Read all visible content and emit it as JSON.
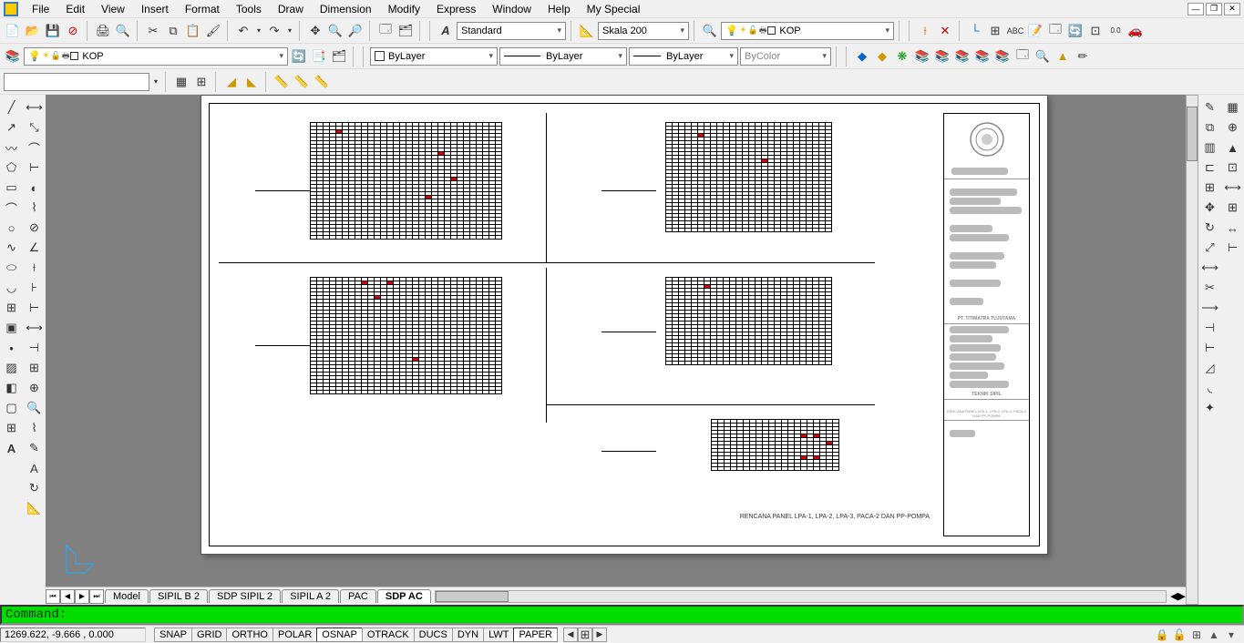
{
  "menu": [
    "File",
    "Edit",
    "View",
    "Insert",
    "Format",
    "Tools",
    "Draw",
    "Dimension",
    "Modify",
    "Express",
    "Window",
    "Help",
    "My Special"
  ],
  "toolbar1": {
    "text_style": "Standard",
    "dim_style": "Skala 200",
    "layer_combo": "KOP"
  },
  "toolbar2": {
    "layer_combo": "KOP",
    "color": "ByLayer",
    "linetype": "ByLayer",
    "lineweight": "ByLayer",
    "plot_style": "ByColor"
  },
  "tabs": [
    "Model",
    "SIPIL B 2",
    "SDP SIPIL 2",
    "SIPIL A 2",
    "PAC",
    "SDP AC"
  ],
  "active_tab": 5,
  "command_prompt": "Command:",
  "coords": "1269.622, -9.666 , 0.000",
  "status_toggles": [
    "SNAP",
    "GRID",
    "ORTHO",
    "POLAR",
    "OSNAP",
    "OTRACK",
    "DUCS",
    "DYN",
    "LWT",
    "PAPER"
  ],
  "active_toggles": [
    "OSNAP",
    "PAPER"
  ],
  "sheet": {
    "title_label": "RENCANA PANEL LPA-1, LPA-2, LPA-3, PACA-2 DAN PP-POMPA",
    "title_block": {
      "consultant": "PT. TITIMATRA TUJUTAMA",
      "section1": "TEKNIK SIPIL",
      "section2": "RENCANA PANEL LPA-1, LPA-2, LPA-3, PACA-2 DAN PP-POMPA"
    }
  }
}
